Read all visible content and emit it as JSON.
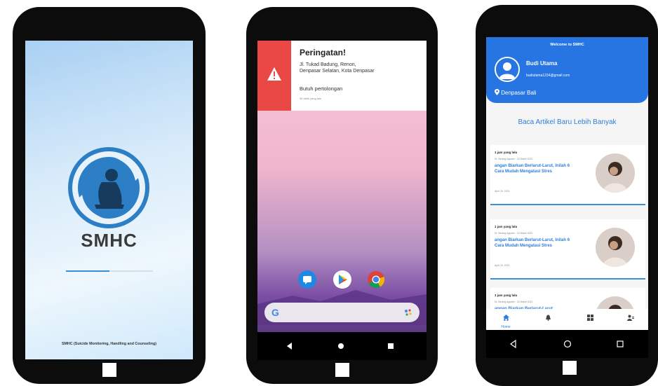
{
  "splash": {
    "brand": "SMHC",
    "progress": 0.5,
    "footer": "SMHC (Suicide Monitoring, Handling and Counseling)"
  },
  "notification": {
    "title": "Peringatan!",
    "address_line1": "Jl. Tukad Badung, Renon,",
    "address_line2": "Denpasar Selatan, Kota Denpasar",
    "message": "Butuh pertolongan",
    "time": "30 detik yang lalu",
    "dock_icons": [
      "message-icon",
      "play-store-icon",
      "chrome-icon"
    ],
    "search_letter": "G"
  },
  "home": {
    "welcome": "Welcome to SMHC",
    "user_name": "Budi Utama",
    "user_email": "budiutama1234@gmail.com",
    "location": "Denpasar Bali",
    "cta": "Baca Artikel Baru Lebih Banyak",
    "articles": [
      {
        "time": "1 jam yang lalu",
        "meta": "Dr. Bening Agustin · 22 Maret 2021",
        "title": "angan Biarkan Berlarut-Larut, Inilah 6 Cara Mudah Mengatasi Stres",
        "date": "April 19, 2021"
      },
      {
        "time": "1 jam yang lalu",
        "meta": "Dr. Bening Agustin · 22 Maret 2021",
        "title": "angan Biarkan Berlarut-Larut, Inilah 6 Cara Mudah Mengatasi Stres",
        "date": "April 19, 2021"
      },
      {
        "time": "1 jam yang lalu",
        "meta": "Dr. Bening Agustin · 22 Maret 2021",
        "title": "angan Biarkan Berlarut-Larut,",
        "date": ""
      }
    ],
    "nav": {
      "home_label": "Home"
    }
  },
  "colors": {
    "accent": "#2675e3",
    "alert": "#e94845",
    "text_link": "#2f7ed8"
  }
}
